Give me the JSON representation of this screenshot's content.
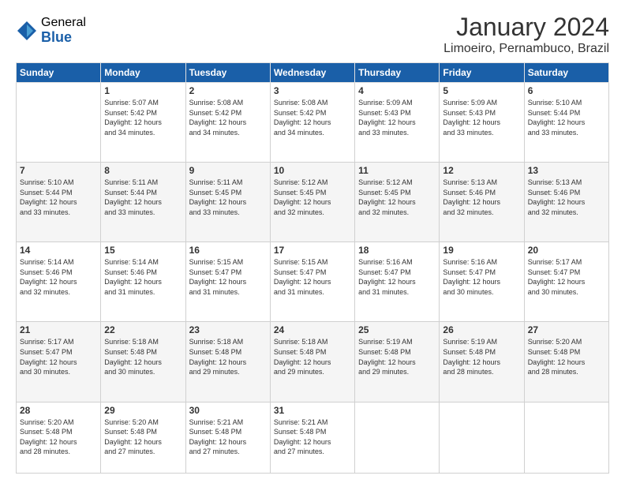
{
  "logo": {
    "general": "General",
    "blue": "Blue"
  },
  "header": {
    "month_year": "January 2024",
    "location": "Limoeiro, Pernambuco, Brazil"
  },
  "weekdays": [
    "Sunday",
    "Monday",
    "Tuesday",
    "Wednesday",
    "Thursday",
    "Friday",
    "Saturday"
  ],
  "weeks": [
    [
      {
        "day": "",
        "info": ""
      },
      {
        "day": "1",
        "info": "Sunrise: 5:07 AM\nSunset: 5:42 PM\nDaylight: 12 hours\nand 34 minutes."
      },
      {
        "day": "2",
        "info": "Sunrise: 5:08 AM\nSunset: 5:42 PM\nDaylight: 12 hours\nand 34 minutes."
      },
      {
        "day": "3",
        "info": "Sunrise: 5:08 AM\nSunset: 5:42 PM\nDaylight: 12 hours\nand 34 minutes."
      },
      {
        "day": "4",
        "info": "Sunrise: 5:09 AM\nSunset: 5:43 PM\nDaylight: 12 hours\nand 33 minutes."
      },
      {
        "day": "5",
        "info": "Sunrise: 5:09 AM\nSunset: 5:43 PM\nDaylight: 12 hours\nand 33 minutes."
      },
      {
        "day": "6",
        "info": "Sunrise: 5:10 AM\nSunset: 5:44 PM\nDaylight: 12 hours\nand 33 minutes."
      }
    ],
    [
      {
        "day": "7",
        "info": "Sunrise: 5:10 AM\nSunset: 5:44 PM\nDaylight: 12 hours\nand 33 minutes."
      },
      {
        "day": "8",
        "info": "Sunrise: 5:11 AM\nSunset: 5:44 PM\nDaylight: 12 hours\nand 33 minutes."
      },
      {
        "day": "9",
        "info": "Sunrise: 5:11 AM\nSunset: 5:45 PM\nDaylight: 12 hours\nand 33 minutes."
      },
      {
        "day": "10",
        "info": "Sunrise: 5:12 AM\nSunset: 5:45 PM\nDaylight: 12 hours\nand 32 minutes."
      },
      {
        "day": "11",
        "info": "Sunrise: 5:12 AM\nSunset: 5:45 PM\nDaylight: 12 hours\nand 32 minutes."
      },
      {
        "day": "12",
        "info": "Sunrise: 5:13 AM\nSunset: 5:46 PM\nDaylight: 12 hours\nand 32 minutes."
      },
      {
        "day": "13",
        "info": "Sunrise: 5:13 AM\nSunset: 5:46 PM\nDaylight: 12 hours\nand 32 minutes."
      }
    ],
    [
      {
        "day": "14",
        "info": "Sunrise: 5:14 AM\nSunset: 5:46 PM\nDaylight: 12 hours\nand 32 minutes."
      },
      {
        "day": "15",
        "info": "Sunrise: 5:14 AM\nSunset: 5:46 PM\nDaylight: 12 hours\nand 31 minutes."
      },
      {
        "day": "16",
        "info": "Sunrise: 5:15 AM\nSunset: 5:47 PM\nDaylight: 12 hours\nand 31 minutes."
      },
      {
        "day": "17",
        "info": "Sunrise: 5:15 AM\nSunset: 5:47 PM\nDaylight: 12 hours\nand 31 minutes."
      },
      {
        "day": "18",
        "info": "Sunrise: 5:16 AM\nSunset: 5:47 PM\nDaylight: 12 hours\nand 31 minutes."
      },
      {
        "day": "19",
        "info": "Sunrise: 5:16 AM\nSunset: 5:47 PM\nDaylight: 12 hours\nand 30 minutes."
      },
      {
        "day": "20",
        "info": "Sunrise: 5:17 AM\nSunset: 5:47 PM\nDaylight: 12 hours\nand 30 minutes."
      }
    ],
    [
      {
        "day": "21",
        "info": "Sunrise: 5:17 AM\nSunset: 5:47 PM\nDaylight: 12 hours\nand 30 minutes."
      },
      {
        "day": "22",
        "info": "Sunrise: 5:18 AM\nSunset: 5:48 PM\nDaylight: 12 hours\nand 30 minutes."
      },
      {
        "day": "23",
        "info": "Sunrise: 5:18 AM\nSunset: 5:48 PM\nDaylight: 12 hours\nand 29 minutes."
      },
      {
        "day": "24",
        "info": "Sunrise: 5:18 AM\nSunset: 5:48 PM\nDaylight: 12 hours\nand 29 minutes."
      },
      {
        "day": "25",
        "info": "Sunrise: 5:19 AM\nSunset: 5:48 PM\nDaylight: 12 hours\nand 29 minutes."
      },
      {
        "day": "26",
        "info": "Sunrise: 5:19 AM\nSunset: 5:48 PM\nDaylight: 12 hours\nand 28 minutes."
      },
      {
        "day": "27",
        "info": "Sunrise: 5:20 AM\nSunset: 5:48 PM\nDaylight: 12 hours\nand 28 minutes."
      }
    ],
    [
      {
        "day": "28",
        "info": "Sunrise: 5:20 AM\nSunset: 5:48 PM\nDaylight: 12 hours\nand 28 minutes."
      },
      {
        "day": "29",
        "info": "Sunrise: 5:20 AM\nSunset: 5:48 PM\nDaylight: 12 hours\nand 27 minutes."
      },
      {
        "day": "30",
        "info": "Sunrise: 5:21 AM\nSunset: 5:48 PM\nDaylight: 12 hours\nand 27 minutes."
      },
      {
        "day": "31",
        "info": "Sunrise: 5:21 AM\nSunset: 5:48 PM\nDaylight: 12 hours\nand 27 minutes."
      },
      {
        "day": "",
        "info": ""
      },
      {
        "day": "",
        "info": ""
      },
      {
        "day": "",
        "info": ""
      }
    ]
  ]
}
